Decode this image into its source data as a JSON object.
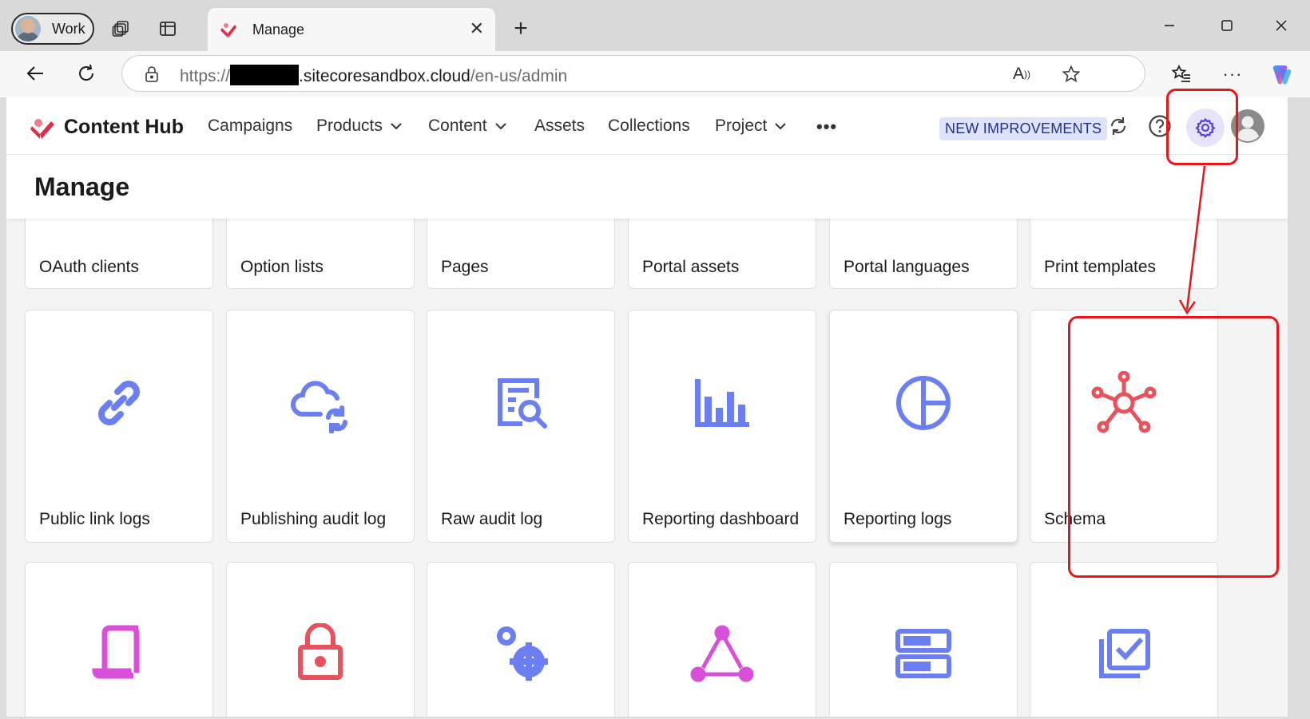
{
  "browser": {
    "profile_label": "Work",
    "tab_title": "Manage",
    "url_prefix": "https://",
    "url_host": ".sitecoresandbox.cloud",
    "url_path": "/en-us/admin"
  },
  "app": {
    "brand": "Content Hub",
    "nav": [
      "Campaigns",
      "Products",
      "Content",
      "Assets",
      "Collections",
      "Project"
    ],
    "more_label": "•••",
    "badge": "NEW IMPROVEMENTS"
  },
  "page": {
    "title": "Manage"
  },
  "cards_row1": [
    "OAuth clients",
    "Option lists",
    "Pages",
    "Portal assets",
    "Portal languages",
    "Print templates"
  ],
  "cards_row2": [
    "Public link logs",
    "Publishing audit log",
    "Raw audit log",
    "Reporting dashboard",
    "Reporting logs",
    "Schema"
  ],
  "colors": {
    "accent": "#6b7ff2",
    "schema": "#e8525d",
    "magenta": "#d94fd9",
    "annotation": "#e8151b"
  }
}
